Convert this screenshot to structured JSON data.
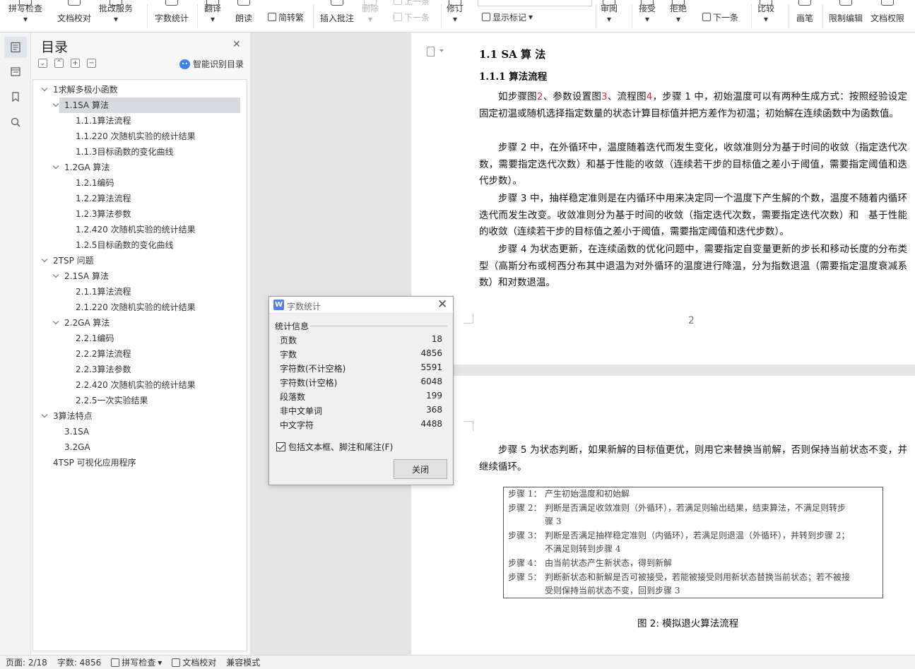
{
  "ribbon": {
    "buttons": [
      {
        "label": "拼写检查",
        "dropdown": true
      },
      {
        "label": "文档校对",
        "dropdown": false
      },
      {
        "label": "批改服务",
        "dropdown": true
      },
      {
        "label": "字数统计",
        "dropdown": false
      },
      {
        "label": "翻译",
        "dropdown": true
      },
      {
        "label": "朗读",
        "dropdown": false
      },
      {
        "label": "简转繁",
        "dropdown": false
      },
      {
        "label": "插入批注",
        "dropdown": false
      },
      {
        "label": "删除",
        "dropdown": true,
        "disabled": true
      },
      {
        "label": "上一条",
        "dropdown": false,
        "disabled": true
      },
      {
        "label": "下一条",
        "dropdown": false,
        "disabled": true
      },
      {
        "label": "修订",
        "dropdown": true
      },
      {
        "label": "显示标记",
        "dropdown": true
      },
      {
        "label": "审阅",
        "dropdown": true
      },
      {
        "label": "接受",
        "dropdown": true
      },
      {
        "label": "拒绝",
        "dropdown": true
      },
      {
        "label": "下一条",
        "dropdown": false
      },
      {
        "label": "比较",
        "dropdown": true
      },
      {
        "label": "画笔",
        "dropdown": false
      },
      {
        "label": "限制编辑",
        "dropdown": false
      },
      {
        "label": "文档权限",
        "dropdown": false
      }
    ]
  },
  "toc": {
    "title": "目录",
    "smart_label": "智能识别目录",
    "tools": [
      "⌄",
      "⌃",
      "+",
      "−"
    ],
    "items": [
      {
        "label": "1求解多极小函数",
        "level": 1,
        "expanded": true
      },
      {
        "label": "1.1SA 算法",
        "level": 2,
        "expanded": true,
        "selected": true
      },
      {
        "label": "1.1.1算法流程",
        "level": 3
      },
      {
        "label": "1.1.220 次随机实验的统计结果",
        "level": 3
      },
      {
        "label": "1.1.3目标函数的变化曲线",
        "level": 3
      },
      {
        "label": "1.2GA 算法",
        "level": 2,
        "expanded": true
      },
      {
        "label": "1.2.1编码",
        "level": 3
      },
      {
        "label": "1.2.2算法流程",
        "level": 3
      },
      {
        "label": "1.2.3算法参数",
        "level": 3
      },
      {
        "label": "1.2.420 次随机实验的统计结果",
        "level": 3
      },
      {
        "label": "1.2.5目标函数的变化曲线",
        "level": 3
      },
      {
        "label": "2TSP 问题",
        "level": 1,
        "expanded": true
      },
      {
        "label": "2.1SA 算法",
        "level": 2,
        "expanded": true
      },
      {
        "label": "2.1.1算法流程",
        "level": 3
      },
      {
        "label": "2.1.220 次随机实验的统计结果",
        "level": 3
      },
      {
        "label": "2.2GA 算法",
        "level": 2,
        "expanded": true
      },
      {
        "label": "2.2.1编码",
        "level": 3
      },
      {
        "label": "2.2.2算法流程",
        "level": 3
      },
      {
        "label": "2.2.3算法参数",
        "level": 3
      },
      {
        "label": "2.2.420 次随机实验的统计结果",
        "level": 3
      },
      {
        "label": "2.2.5一次实验结果",
        "level": 3
      },
      {
        "label": "3算法特点",
        "level": 1,
        "expanded": true
      },
      {
        "label": "3.1SA",
        "level": 2
      },
      {
        "label": "3.2GA",
        "level": 2
      },
      {
        "label": "4TSP 可视化应用程序",
        "level": 1
      }
    ]
  },
  "document": {
    "heading1": "1.1   SA 算 法",
    "heading2": "1.1.1    算法流程",
    "paragraphs": [
      [
        {
          "t": "如步骤图"
        },
        {
          "t": "2",
          "red": true
        },
        {
          "t": "、参数设置图"
        },
        {
          "t": "3",
          "red": true
        },
        {
          "t": "、流程图"
        },
        {
          "t": "4",
          "red": true
        },
        {
          "t": "，步骤 1 中，初始温度可以有两种生成方式：按照经验设定固定初温或随机选择指定数量的状态计算目标值并把方差作为初温；初始解在连续函数中为函数值。"
        }
      ],
      [
        {
          "t": "步骤 2 中，在外循环中，温度随着迭代而发生变化，收敛准则分为基于时间的收敛（指定迭代次数，需要指定迭代次数）和基于性能的收敛（连续若干步的目标值之差小于阈值，需要指定阈值和迭代步数）。"
        }
      ],
      [
        {
          "t": "步骤 3 中，抽样稳定准则是在内循环中用来决定同一个温度下产生解的个数，温度不随着内循环迭代而发生改变。收敛准则分为基于时间的收敛（指定迭代次数，需要指定迭代次数）和　基于性能的收敛（连续若干步的目标值之差小于阈值，需要指定阈值和迭代步数）。"
        }
      ],
      [
        {
          "t": "步骤 4 为状态更新，在连续函数的优化问题中，需要指定自变量更新的步长和移动长度的分布类型（高斯分布或柯西分布其中退温为对外循环的温度进行降温，分为指数退温（需要指定温度衰减系数）和对数退温。"
        }
      ]
    ],
    "page_number": "2",
    "page2_paragraph": "步骤 5 为状态判断，如果新解的目标值更优，则用它来替换当前解，否则保持当前状态不变，并继续循环。",
    "algorithm_box": [
      {
        "label": "步骤 1：",
        "lines": [
          "产生初始温度和初始解"
        ]
      },
      {
        "label": "步骤 2：",
        "lines": [
          "判断是否满足收敛准则（外循环），若满足则输出结果，结束算法，不满足则转步",
          "骤 3"
        ]
      },
      {
        "label": "步骤 3：",
        "lines": [
          "判断是否满足抽样稳定准则（内循环），若满足则退温（外循环），并转到步骤 2；",
          "不满足则转到步骤 4"
        ]
      },
      {
        "label": "步骤 4：",
        "lines": [
          "由当前状态产生新状态，得到新解"
        ]
      },
      {
        "label": "步骤 5：",
        "lines": [
          "判断新状态和新解是否可被接受，若能被接受则用新状态替换当前状态；若不被接",
          "受则保持当前状态不变，回到步骤 3"
        ]
      }
    ],
    "caption": "图 2: 模拟退火算法流程"
  },
  "dialog": {
    "title": "字数统计",
    "section": "统计信息",
    "stats": [
      {
        "label": "页数",
        "value": "18"
      },
      {
        "label": "字数",
        "value": "4856"
      },
      {
        "label": "字符数(不计空格)",
        "value": "5591"
      },
      {
        "label": "字符数(计空格)",
        "value": "6048"
      },
      {
        "label": "段落数",
        "value": "199"
      },
      {
        "label": "非中文单词",
        "value": "368"
      },
      {
        "label": "中文字符",
        "value": "4488"
      }
    ],
    "checkbox_label": "包括文本框、脚注和尾注(F)",
    "checkbox_checked": true,
    "close_label": "关闭"
  },
  "status": {
    "page": "页面: 2/18",
    "words": "字数: 4856",
    "spell": "拼写检查",
    "proof": "文档校对",
    "mode": "兼容模式"
  },
  "colors": {
    "accent": "#3d7ff5",
    "red_ref": "#e03030",
    "selection": "#d6d9de"
  }
}
